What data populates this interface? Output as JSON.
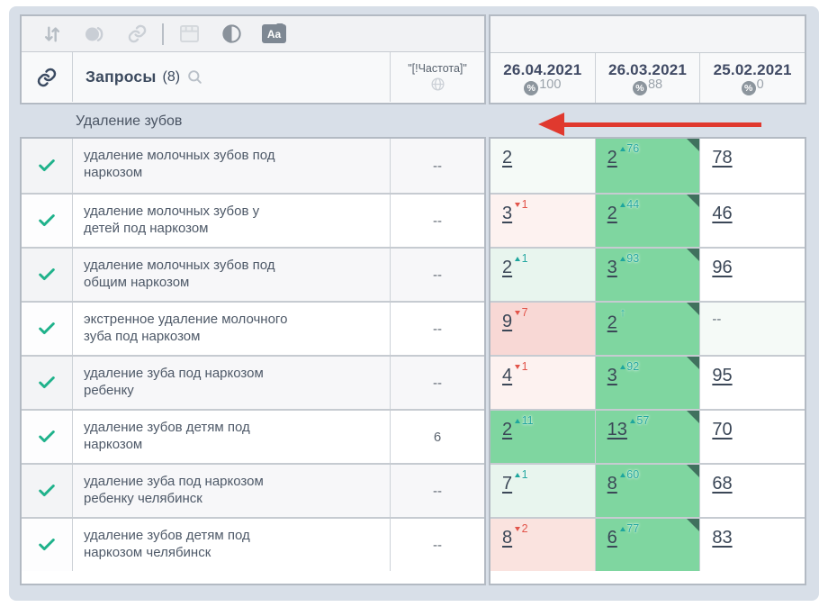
{
  "header": {
    "queries_label": "Запросы",
    "queries_count": "(8)",
    "frequency_label": "\"[!Частота]\"",
    "date_columns": [
      {
        "date": "26.04.2021",
        "coverage": "100",
        "percent_sign": "%"
      },
      {
        "date": "26.03.2021",
        "coverage": "88",
        "percent_sign": "%"
      },
      {
        "date": "25.02.2021",
        "coverage": "0",
        "percent_sign": "%"
      }
    ]
  },
  "toolbar": {
    "text_style_label": "Aa"
  },
  "group": {
    "title": "Удаление зубов"
  },
  "colors": {
    "green_cell": "#7fd6a0",
    "light_green_cell": "#e8f5ee",
    "pink_cell": "#f8d8d5",
    "light_pink_cell": "#fdf2f0",
    "up_delta": "#21a69e",
    "down_delta": "#e2544a",
    "arrow_red": "#e0392e",
    "check_green": "#1fb28b"
  },
  "rows": [
    {
      "keyword": "удаление молочных зубов под наркозом",
      "frequency": "--",
      "cells": [
        {
          "value": "2",
          "delta": "",
          "dir": "none",
          "bg": "#f5faf7",
          "fold": false
        },
        {
          "value": "2",
          "delta": "76",
          "dir": "up",
          "bg": "#7fd6a0",
          "fold": true
        },
        {
          "value": "78",
          "delta": "",
          "dir": "none",
          "bg": "#ffffff",
          "fold": false
        }
      ]
    },
    {
      "keyword": "удаление молочных зубов у детей под наркозом",
      "frequency": "--",
      "cells": [
        {
          "value": "3",
          "delta": "1",
          "dir": "down",
          "bg": "#fdf2f0",
          "fold": false
        },
        {
          "value": "2",
          "delta": "44",
          "dir": "up",
          "bg": "#7fd6a0",
          "fold": true
        },
        {
          "value": "46",
          "delta": "",
          "dir": "none",
          "bg": "#ffffff",
          "fold": false
        }
      ]
    },
    {
      "keyword": "удаление молочных зубов под общим наркозом",
      "frequency": "--",
      "cells": [
        {
          "value": "2",
          "delta": "1",
          "dir": "up",
          "bg": "#e8f5ee",
          "fold": false
        },
        {
          "value": "3",
          "delta": "93",
          "dir": "up",
          "bg": "#7fd6a0",
          "fold": true
        },
        {
          "value": "96",
          "delta": "",
          "dir": "none",
          "bg": "#ffffff",
          "fold": false
        }
      ]
    },
    {
      "keyword": "экстренное удаление молочного зуба под наркозом",
      "frequency": "--",
      "cells": [
        {
          "value": "9",
          "delta": "7",
          "dir": "down",
          "bg": "#f8d8d5",
          "fold": false
        },
        {
          "value": "2",
          "delta": "",
          "dir": "new",
          "bg": "#7fd6a0",
          "fold": true
        },
        {
          "value": "--",
          "delta": "",
          "dir": "none",
          "bg": "#f5faf7",
          "fold": false
        }
      ]
    },
    {
      "keyword": "удаление зуба под наркозом ребенку",
      "frequency": "--",
      "cells": [
        {
          "value": "4",
          "delta": "1",
          "dir": "down",
          "bg": "#fdf2f0",
          "fold": false
        },
        {
          "value": "3",
          "delta": "92",
          "dir": "up",
          "bg": "#7fd6a0",
          "fold": true
        },
        {
          "value": "95",
          "delta": "",
          "dir": "none",
          "bg": "#ffffff",
          "fold": false
        }
      ]
    },
    {
      "keyword": "удаление зубов детям под наркозом",
      "frequency": "6",
      "cells": [
        {
          "value": "2",
          "delta": "11",
          "dir": "up",
          "bg": "#7fd6a0",
          "fold": false
        },
        {
          "value": "13",
          "delta": "57",
          "dir": "up",
          "bg": "#7fd6a0",
          "fold": true
        },
        {
          "value": "70",
          "delta": "",
          "dir": "none",
          "bg": "#ffffff",
          "fold": false
        }
      ]
    },
    {
      "keyword": "удаление зуба под наркозом ребенку челябинск",
      "frequency": "--",
      "cells": [
        {
          "value": "7",
          "delta": "1",
          "dir": "up",
          "bg": "#e8f5ee",
          "fold": false
        },
        {
          "value": "8",
          "delta": "60",
          "dir": "up",
          "bg": "#7fd6a0",
          "fold": true
        },
        {
          "value": "68",
          "delta": "",
          "dir": "none",
          "bg": "#ffffff",
          "fold": false
        }
      ]
    },
    {
      "keyword": "удаление зубов детям под наркозом челябинск",
      "frequency": "--",
      "cells": [
        {
          "value": "8",
          "delta": "2",
          "dir": "down",
          "bg": "#fae3df",
          "fold": false
        },
        {
          "value": "6",
          "delta": "77",
          "dir": "up",
          "bg": "#7fd6a0",
          "fold": true
        },
        {
          "value": "83",
          "delta": "",
          "dir": "none",
          "bg": "#ffffff",
          "fold": false
        }
      ]
    }
  ]
}
